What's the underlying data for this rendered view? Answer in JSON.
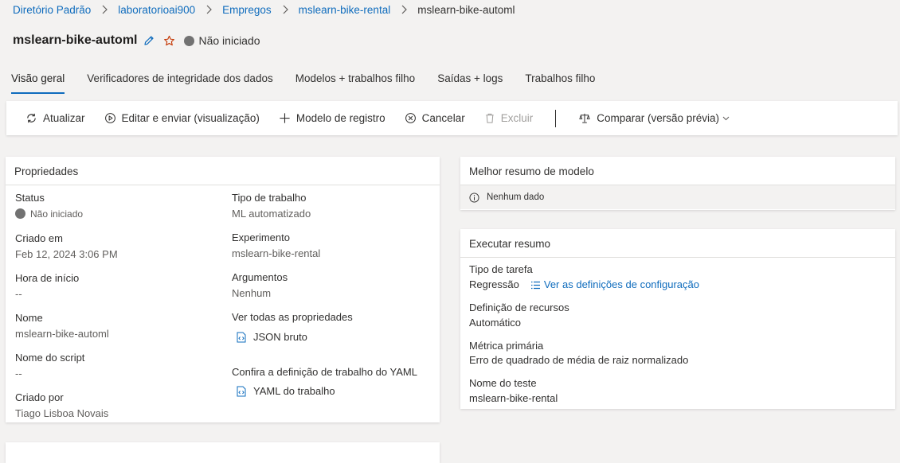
{
  "breadcrumb": {
    "items": [
      "Diretório Padrão",
      "laboratorioai900",
      "Empregos",
      "mslearn-bike-rental"
    ],
    "current": "mslearn-bike-automl"
  },
  "header": {
    "title": "mslearn-bike-automl",
    "status": "Não iniciado"
  },
  "tabs": [
    {
      "label": "Visão geral"
    },
    {
      "label": "Verificadores de integridade dos dados"
    },
    {
      "label": "Modelos + trabalhos filho"
    },
    {
      "label": "Saídas + logs"
    },
    {
      "label": "Trabalhos filho"
    }
  ],
  "toolbar": {
    "refresh": "Atualizar",
    "edit_submit": "Editar e enviar (visualização)",
    "register_model": "Modelo de registro",
    "cancel": "Cancelar",
    "delete": "Excluir",
    "compare": "Comparar (versão prévia)"
  },
  "properties": {
    "title": "Propriedades",
    "status_label": "Status",
    "status_value": "Não iniciado",
    "created_label": "Criado em",
    "created_value": "Feb 12, 2024 3:06 PM",
    "start_label": "Hora de início",
    "start_value": "--",
    "name_label": "Nome",
    "name_value": "mslearn-bike-automl",
    "script_label": "Nome do script",
    "script_value": "--",
    "createdby_label": "Criado por",
    "createdby_value": "Tiago Lisboa Novais",
    "jobtype_label": "Tipo de trabalho",
    "jobtype_value": "ML automatizado",
    "experiment_label": "Experimento",
    "experiment_value": "mslearn-bike-rental",
    "args_label": "Argumentos",
    "args_value": "Nenhum",
    "allprops_label": "Ver todas as propriedades",
    "raw_json": "JSON bruto",
    "yaml_label": "Confira a definição de trabalho do YAML",
    "yaml_link": "YAML do trabalho"
  },
  "best_model": {
    "title": "Melhor resumo de modelo",
    "nodata": "Nenhum dado"
  },
  "run_summary": {
    "title": "Executar resumo",
    "task_label": "Tipo de tarefa",
    "task_value": "Regressão",
    "config_link": "Ver as definições de configuração",
    "resource_label": "Definição de recursos",
    "resource_value": "Automático",
    "metric_label": "Métrica primária",
    "metric_value": "Erro de quadrado de média de raiz normalizado",
    "test_label": "Nome do teste",
    "test_value": "mslearn-bike-rental"
  },
  "colors": {
    "accent": "#0f6cbd",
    "star": "#c43501",
    "status_gray": "#727272"
  }
}
